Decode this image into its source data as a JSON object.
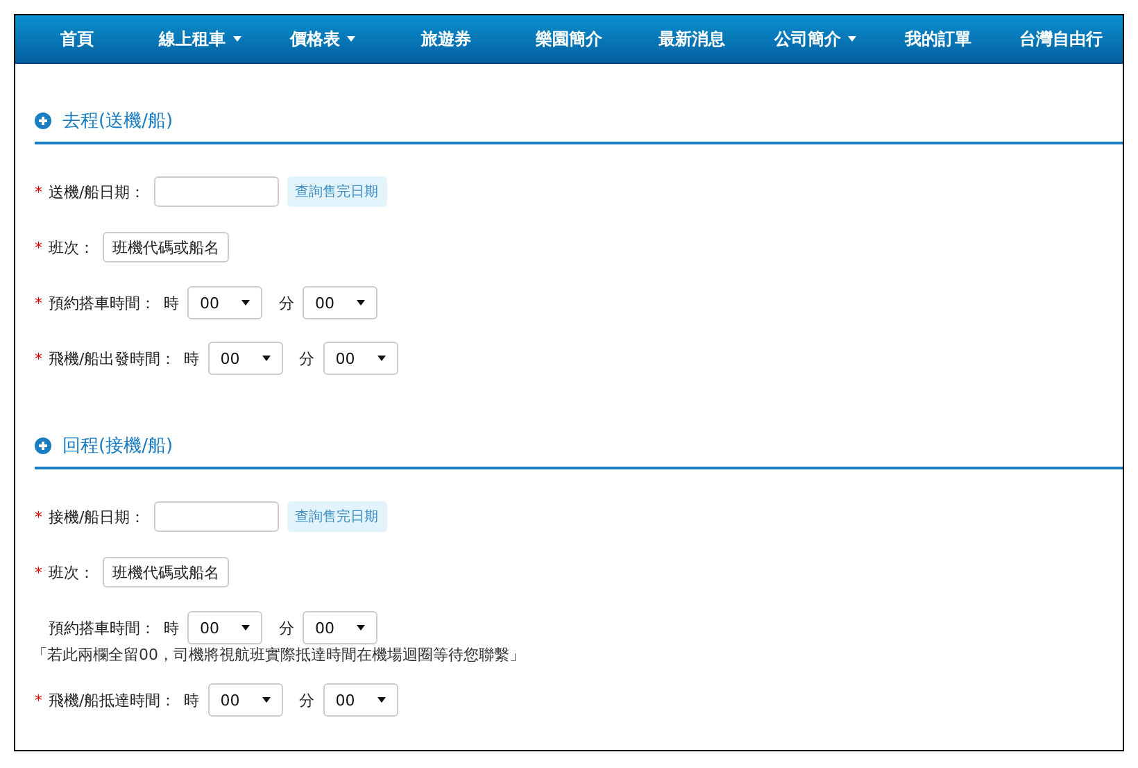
{
  "nav": [
    {
      "label": "首頁",
      "dropdown": false
    },
    {
      "label": "線上租車",
      "dropdown": true
    },
    {
      "label": "價格表",
      "dropdown": true
    },
    {
      "label": "旅遊券",
      "dropdown": false
    },
    {
      "label": "樂園簡介",
      "dropdown": false
    },
    {
      "label": "最新消息",
      "dropdown": false
    },
    {
      "label": "公司簡介",
      "dropdown": true
    },
    {
      "label": "我的訂單",
      "dropdown": false
    },
    {
      "label": "台灣自由行",
      "dropdown": false
    }
  ],
  "sections": [
    {
      "title": "去程(送機/船)",
      "rows": [
        {
          "kind": "date",
          "required_mark": "*",
          "label": "送機/船日期：",
          "button": {
            "label": "查詢售完日期",
            "disabled": true
          }
        },
        {
          "kind": "flight",
          "required_mark": "*",
          "label": "班次：",
          "value": "班機代碼或船名"
        },
        {
          "kind": "time",
          "required_mark": "*",
          "label": "預約搭車時間：",
          "hour_label": "時",
          "hour": "00",
          "minute_label": "分",
          "minute": "00"
        },
        {
          "kind": "time",
          "required_mark": "*",
          "label": "飛機/船出發時間：",
          "hour_label": "時",
          "hour": "00",
          "minute_label": "分",
          "minute": "00"
        }
      ]
    },
    {
      "title": "回程(接機/船)",
      "rows": [
        {
          "kind": "date",
          "required_mark": "*",
          "label": "接機/船日期：",
          "button": {
            "label": "查詢售完日期",
            "disabled": true
          }
        },
        {
          "kind": "flight",
          "required_mark": "*",
          "label": "班次：",
          "value": "班機代碼或船名"
        },
        {
          "kind": "time",
          "label": "預約搭車時間：",
          "hour_label": "時",
          "hour": "00",
          "minute_label": "分",
          "minute": "00"
        },
        {
          "kind": "note",
          "text": "「若此兩欄全留00，司機將視航班實際抵達時間在機場迴圈等待您聯繫」"
        },
        {
          "kind": "time",
          "required_mark": "*",
          "label": "飛機/船抵達時間：",
          "hour_label": "時",
          "hour": "00",
          "minute_label": "分",
          "minute": "00"
        }
      ]
    }
  ]
}
